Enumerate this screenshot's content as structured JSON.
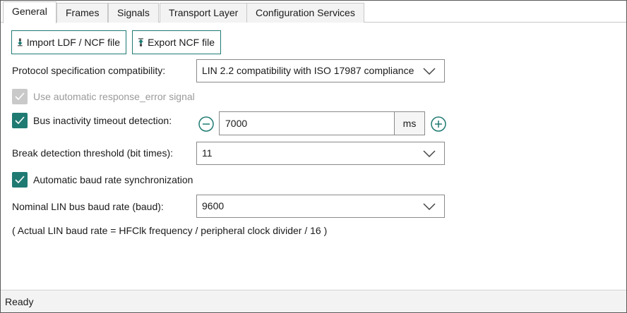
{
  "tabs": [
    {
      "label": "General",
      "active": true
    },
    {
      "label": "Frames",
      "active": false
    },
    {
      "label": "Signals",
      "active": false
    },
    {
      "label": "Transport Layer",
      "active": false
    },
    {
      "label": "Configuration Services",
      "active": false
    }
  ],
  "toolbar": {
    "import_label": "Import LDF / NCF file",
    "export_label": "Export NCF file",
    "import_icon": "download-arrow-icon",
    "export_icon": "upload-arrow-icon"
  },
  "protocol": {
    "label": "Protocol specification compatibility:",
    "value": "LIN 2.2 compatibility with ISO 17987 compliance"
  },
  "response_error": {
    "label": "Use automatic response_error signal",
    "checked": true,
    "enabled": false
  },
  "bus_inactivity": {
    "label": "Bus inactivity timeout detection:",
    "checked": true,
    "value": "7000",
    "unit": "ms"
  },
  "break_detection": {
    "label": "Break detection threshold (bit times):",
    "value": "11"
  },
  "auto_baud": {
    "label": "Automatic baud rate synchronization",
    "checked": true
  },
  "baud_rate": {
    "label": "Nominal LIN bus baud rate (baud):",
    "value": "9600"
  },
  "note": "( Actual LIN baud rate = HFClk frequency / peripheral clock divider / 16 )",
  "status": "Ready",
  "colors": {
    "accent": "#1f7a72",
    "disabled": "#c9c9c9",
    "border": "#8a8a8a"
  }
}
